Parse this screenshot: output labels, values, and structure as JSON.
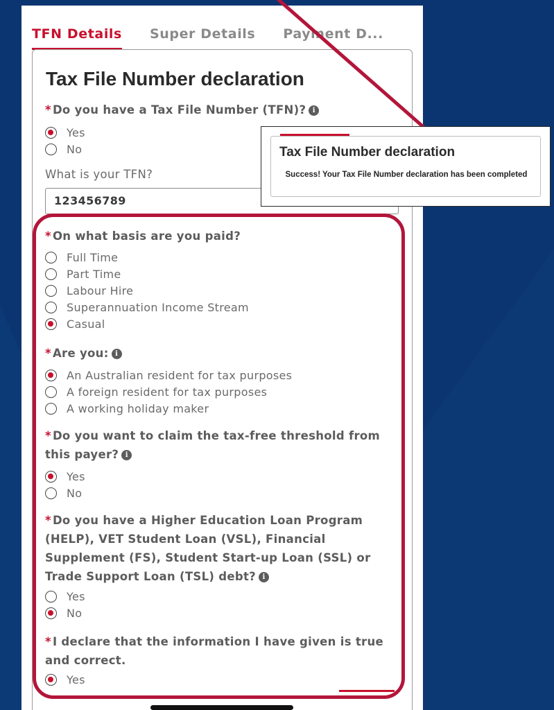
{
  "tabs": [
    {
      "label": "TFN Details",
      "active": true
    },
    {
      "label": "Super Details",
      "active": false
    },
    {
      "label": "Payment D...",
      "active": false
    }
  ],
  "form": {
    "title": "Tax File Number declaration",
    "q_has_tfn": {
      "label": "Do you have a Tax File Number (TFN)?",
      "options": [
        "Yes",
        "No"
      ],
      "selected": "Yes"
    },
    "tfn_label": "What is your TFN?",
    "tfn_value": "123456789",
    "q_basis": {
      "label": "On what basis are you paid?",
      "options": [
        "Full Time",
        "Part Time",
        "Labour Hire",
        "Superannuation Income Stream",
        "Casual"
      ],
      "selected": "Casual"
    },
    "q_are_you": {
      "label": "Are you:",
      "options": [
        "An Australian resident for tax purposes",
        "A foreign resident for tax purposes",
        "A working holiday maker"
      ],
      "selected": "An Australian resident for tax purposes"
    },
    "q_threshold": {
      "label": "Do you want to claim the tax-free threshold from this payer?",
      "options": [
        "Yes",
        "No"
      ],
      "selected": "Yes"
    },
    "q_help": {
      "label": "Do you have a Higher Education Loan Program (HELP), VET Student Loan (VSL), Financial Supplement (FS), Student Start-up Loan (SSL) or Trade Support Loan (TSL) debt?",
      "options": [
        "Yes",
        "No"
      ],
      "selected": "No"
    },
    "q_declare": {
      "label": "I declare that the information I have given is true and correct.",
      "options": [
        "Yes"
      ],
      "selected": "Yes"
    },
    "required_marker": "*",
    "info_glyph": "i"
  },
  "toast": {
    "title": "Tax File Number declaration",
    "message": "Success! Your Tax File Number declaration has been completed"
  },
  "colors": {
    "accent": "#c8102e",
    "highlight": "#b3163a",
    "background": "#0b3570"
  }
}
